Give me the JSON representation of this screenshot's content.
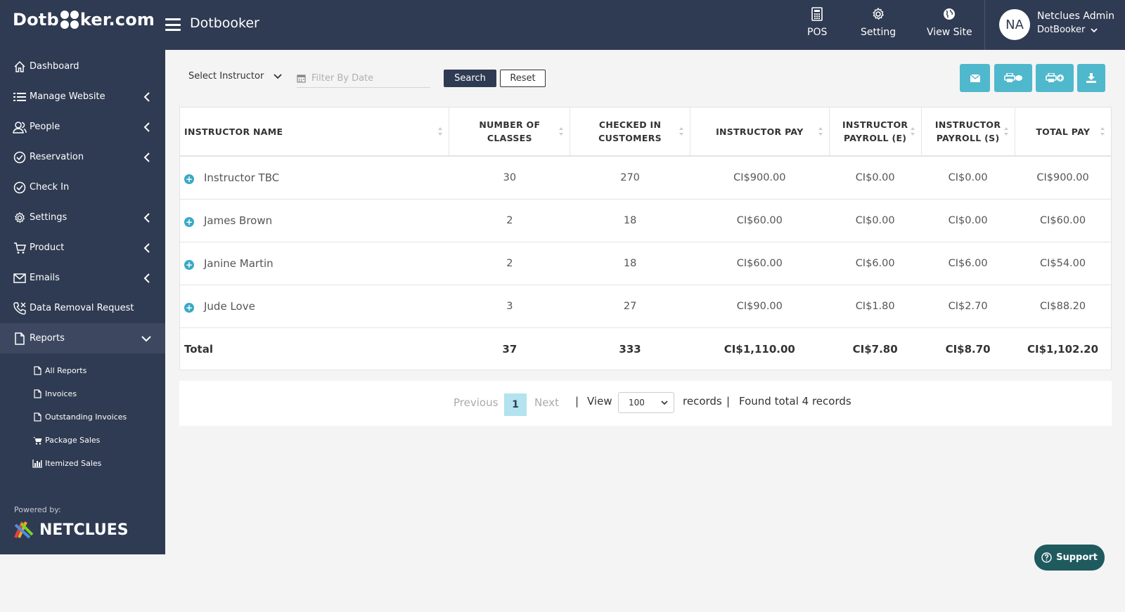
{
  "header": {
    "logo": {
      "left": "Dotb",
      "right": "ker.com"
    },
    "brand_title": "Dotbooker",
    "nav": [
      {
        "label": "POS",
        "icon": "calculator-icon"
      },
      {
        "label": "Setting",
        "icon": "gear-icon"
      },
      {
        "label": "View Site",
        "icon": "globe-icon"
      }
    ],
    "user": {
      "initials": "NA",
      "name": "Netclues Admin",
      "org": "DotBooker"
    }
  },
  "sidebar": {
    "items": [
      {
        "label": "Dashboard",
        "icon": "home-icon",
        "has_chevron": false
      },
      {
        "label": "Manage Website",
        "icon": "list-icon",
        "has_chevron": true
      },
      {
        "label": "People",
        "icon": "users-icon",
        "has_chevron": true
      },
      {
        "label": "Reservation",
        "icon": "check-circle-icon",
        "has_chevron": true
      },
      {
        "label": "Check In",
        "icon": "check-circle-icon",
        "has_chevron": false
      },
      {
        "label": "Settings",
        "icon": "gear-icon",
        "has_chevron": true
      },
      {
        "label": "Product",
        "icon": "cart-icon",
        "has_chevron": true
      },
      {
        "label": "Emails",
        "icon": "envelope-icon",
        "has_chevron": true
      },
      {
        "label": "Data Removal Request",
        "icon": "phone-icon",
        "has_chevron": false
      },
      {
        "label": "Reports",
        "icon": "document-icon",
        "has_chevron": true,
        "expanded": true
      }
    ],
    "report_subitems": [
      {
        "label": "All Reports",
        "icon": "file-icon"
      },
      {
        "label": "Invoices",
        "icon": "file-icon"
      },
      {
        "label": "Outstanding Invoices",
        "icon": "file-icon"
      },
      {
        "label": "Package Sales",
        "icon": "cart-icon"
      },
      {
        "label": "Itemized Sales",
        "icon": "bar-chart-icon"
      }
    ],
    "powered_by": "Powered by:",
    "netclues": "NETCLUES"
  },
  "filters": {
    "instructor_select": "Select Instructor",
    "date_placeholder": "Filter By Date",
    "search_label": "Search",
    "reset_label": "Reset",
    "actions": [
      "envelope-icon",
      "print-icon",
      "print-add-icon",
      "download-icon"
    ]
  },
  "table": {
    "columns": [
      "INSTRUCTOR NAME",
      "NUMBER OF CLASSES",
      "CHECKED IN CUSTOMERS",
      "INSTRUCTOR PAY",
      "INSTRUCTOR PAYROLL (E)",
      "INSTRUCTOR PAYROLL (S)",
      "TOTAL PAY"
    ],
    "rows": [
      [
        "Instructor TBC",
        "30",
        "270",
        "CI$900.00",
        "CI$0.00",
        "CI$0.00",
        "CI$900.00"
      ],
      [
        "James Brown",
        "2",
        "18",
        "CI$60.00",
        "CI$0.00",
        "CI$0.00",
        "CI$60.00"
      ],
      [
        "Janine Martin",
        "2",
        "18",
        "CI$60.00",
        "CI$6.00",
        "CI$6.00",
        "CI$54.00"
      ],
      [
        "Jude Love",
        "3",
        "27",
        "CI$90.00",
        "CI$1.80",
        "CI$2.70",
        "CI$88.20"
      ]
    ],
    "total": [
      "Total",
      "37",
      "333",
      "CI$1,110.00",
      "CI$7.80",
      "CI$8.70",
      "CI$1,102.20"
    ]
  },
  "pagination": {
    "previous": "Previous",
    "current_page": "1",
    "next": "Next",
    "separator": "|",
    "view_label": "View",
    "page_size": "100",
    "records_label": "records",
    "found_text": "Found total 4 records"
  },
  "support_label": "Support",
  "colors": {
    "navy": "#2f3b52",
    "accent": "#4fb8cc",
    "support": "#1f5a5e"
  }
}
